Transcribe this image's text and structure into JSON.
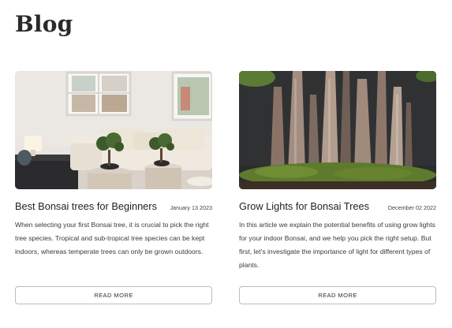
{
  "page": {
    "title": "Blog"
  },
  "posts": [
    {
      "image": "living-room-bonsai-photo",
      "title": "Best Bonsai trees for Beginners",
      "date": "January 13 2023",
      "excerpt": "When selecting your first Bonsai tree, it is crucial to pick the right tree species. Tropical and sub-tropical tree species can be kept indoors, whereas temperate trees can only be grown outdoors.",
      "button": "READ MORE"
    },
    {
      "image": "bonsai-forest-photo",
      "title": "Grow Lights for Bonsai Trees",
      "date": "December 02 2022",
      "excerpt": "In this article we explain the potential benefits of using grow lights for your indoor Bonsai, and we help you pick the right setup. But first, let's investigate the importance of light for different types of plants.",
      "button": "READ MORE"
    }
  ]
}
